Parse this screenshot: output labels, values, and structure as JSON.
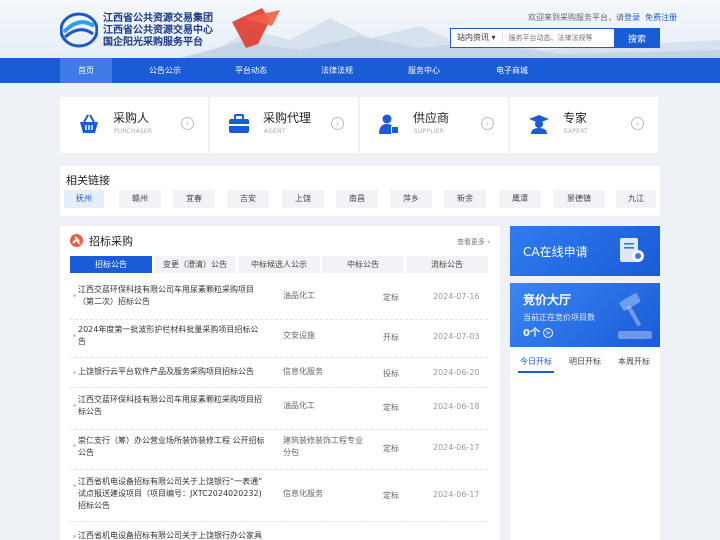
{
  "header": {
    "brand_lines": [
      "江西省公共资源交易集团",
      "江西省公共资源交易中心",
      "国企阳光采购服务平台"
    ],
    "welcome_text": "欢迎来到采购服务平台，请",
    "login_label": "登录",
    "register_label": "免费注册",
    "search_scope": "站内资讯",
    "search_placeholder": "服务平台动态、法律法规等",
    "search_button": "搜索"
  },
  "nav": {
    "items": [
      "首页",
      "公告公示",
      "平台动态",
      "法律法规",
      "服务中心",
      "电子商城"
    ],
    "active": 0
  },
  "roles": [
    {
      "title": "采购人",
      "subtitle": "PURCHASER",
      "icon": "basket-icon"
    },
    {
      "title": "采购代理",
      "subtitle": "AGENT",
      "icon": "briefcase-icon"
    },
    {
      "title": "供应商",
      "subtitle": "SUPPLIER",
      "icon": "supplier-icon"
    },
    {
      "title": "专家",
      "subtitle": "EXPERT",
      "icon": "expert-icon"
    }
  ],
  "related_links": {
    "title": "相关链接",
    "cities": [
      "抚州",
      "赣州",
      "宜春",
      "吉安",
      "上饶",
      "南昌",
      "萍乡",
      "新余",
      "鹰潭",
      "景德镇",
      "九江"
    ],
    "active": 0
  },
  "bidding": {
    "title": "招标采购",
    "more": "查看更多",
    "tabs": [
      "招标公告",
      "变更（澄清）公告",
      "中标候选人公示",
      "中标公告",
      "流标公告"
    ],
    "active_tab": 0,
    "rows": [
      {
        "lines": [
          "江西交蓝环保科技有限公司车用尿素颗粒采购项目",
          "（第二次）招标公告"
        ],
        "category": [
          "油品化工"
        ],
        "type": "定标",
        "date": "2024-07-16"
      },
      {
        "lines": [
          "2024年度第一批波形护栏材料批量采购项目招标公",
          "告"
        ],
        "category": [
          "交安设施"
        ],
        "type": "开标",
        "date": "2024-07-03"
      },
      {
        "lines": [
          "上饶银行云平台软件产品及服务采购项目招标公告"
        ],
        "category": [
          "信息化服务"
        ],
        "type": "投标",
        "date": "2024-06-20"
      },
      {
        "lines": [
          "江西交蓝环保科技有限公司车用尿素颗粒采购项目招",
          "标公告"
        ],
        "category": [
          "油品化工"
        ],
        "type": "定标",
        "date": "2024-06-18"
      },
      {
        "lines": [
          "崇仁支行（筹）办公营业场所装饰装修工程 公开招标",
          "公告"
        ],
        "category": [
          "建筑装修装饰工程专业",
          "分包"
        ],
        "type": "定标",
        "date": "2024-06-17"
      },
      {
        "lines": [
          "江西省机电设备招标有限公司关于上饶银行“一表通”",
          "试点报送建设项目（项目编号：JXTC2024020232)",
          "招标公告"
        ],
        "category": [
          "信息化服务"
        ],
        "type": "定标",
        "date": "2024-06-17"
      },
      {
        "lines": [
          "江西省机电设备招标有限公司关于上饶银行办公家具"
        ],
        "category": [],
        "type": "",
        "date": ""
      }
    ]
  },
  "ca": {
    "title": "CA在线申请",
    "icon": "certificate-icon"
  },
  "auction": {
    "title": "竞价大厅",
    "subtitle": "当前正在竞价项目数",
    "count": "0个",
    "arrow": ">",
    "icon": "gavel-icon",
    "tabs": [
      "今日开标",
      "明日开标",
      "本周开标"
    ],
    "active_tab": 0
  },
  "colors": {
    "primary": "#1a5bd6",
    "nav_active": "#3f7ae6",
    "accent_red": "#ef5b43"
  }
}
